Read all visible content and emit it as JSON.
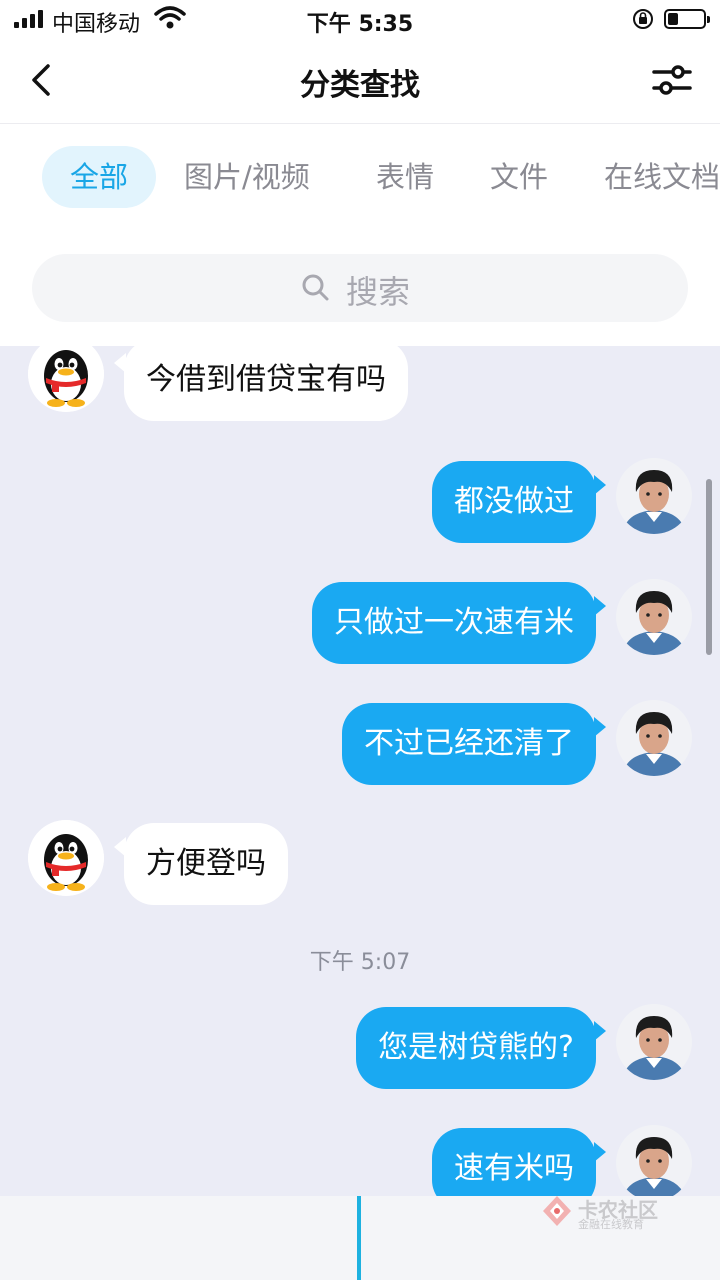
{
  "status_bar": {
    "carrier": "中国移动",
    "time": "下午 5:35",
    "battery_level": 0.3
  },
  "header": {
    "title": "分类查找",
    "back_icon": "chevron-left-icon",
    "filter_icon": "sliders-icon"
  },
  "tabs": [
    {
      "label": "全部",
      "active": true
    },
    {
      "label": "图片/视频",
      "active": false
    },
    {
      "label": "表情",
      "active": false
    },
    {
      "label": "文件",
      "active": false
    },
    {
      "label": "在线文档",
      "active": false
    }
  ],
  "search": {
    "placeholder": "搜索"
  },
  "messages": [
    {
      "side": "in",
      "text": "今借到借贷宝有吗"
    },
    {
      "side": "out",
      "text": "都没做过"
    },
    {
      "side": "out",
      "text": "只做过一次速有米"
    },
    {
      "side": "out",
      "text": "不过已经还清了"
    },
    {
      "side": "in",
      "text": "方便登吗"
    },
    {
      "side": "time",
      "text": "下午 5:07"
    },
    {
      "side": "out",
      "text": "您是树贷熊的?"
    },
    {
      "side": "out",
      "text": "速有米吗"
    }
  ],
  "watermark": {
    "title": "卡农社区",
    "subtitle": "金融在线教育"
  },
  "colors": {
    "accent": "#1aa9f2",
    "chat_background": "#ebecf6",
    "tab_active_bg": "#e2f4fd"
  }
}
